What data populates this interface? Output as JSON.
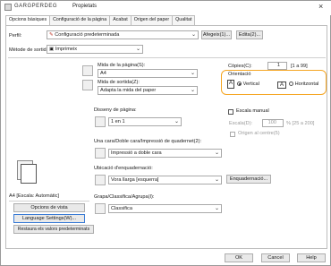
{
  "window": {
    "title": "Propietats",
    "printer_name": "GARGPERDEG"
  },
  "tabs": [
    "Opcions bàsiques",
    "Configuració de la pàgina",
    "Acabat",
    "Origen del paper",
    "Qualitat"
  ],
  "profile": {
    "label": "Perfil:",
    "value": "Configuració predeterminada",
    "add_button": "Afegeix(1)...",
    "edit_button": "Edita(2)..."
  },
  "output_method": {
    "label": "Mètode de sortida:",
    "value": "Imprimeix"
  },
  "page_size": {
    "label": "Mida de la pàgina(S):",
    "value": "A4"
  },
  "output_size": {
    "label": "Mida de sortida(Z):",
    "value": "Adapta la mida del paper"
  },
  "copies": {
    "label": "Còpies(C):",
    "value": "1",
    "range": "[1 a 99]"
  },
  "orientation": {
    "label": "Orientació",
    "vertical": "Vertical",
    "horizontal": "Horitzontal",
    "selected": "vertical"
  },
  "layout": {
    "label": "Disseny de pàgina:",
    "value": "1 en 1"
  },
  "manual_scale": {
    "label": "Escala manual",
    "scale_label": "Escala(D):",
    "scale_value": "100",
    "scale_range": "% [25 a 200]",
    "center_label": "Origen al centre(5)"
  },
  "duplex": {
    "label": "Una cara/Doble cara/Impressió de quadernet(2):",
    "value": "Impressió a doble cara"
  },
  "binding": {
    "label": "Ubicació d'enquadernació:",
    "value": "Vora llarga [esquerra]",
    "button": "Enquadernació..."
  },
  "staple": {
    "label": "Grapa/Classifica/Agrupa(I):",
    "value": "Classifica"
  },
  "preview": {
    "caption": "A4 [Escala: Automàtic]"
  },
  "side_buttons": {
    "view_options": "Opcions de vista",
    "language": "Language Settings(W)...",
    "restore": "Restaura els valors predeterminats"
  },
  "footer": {
    "ok": "OK",
    "cancel": "Cancel",
    "help": "Help"
  },
  "colors": {
    "highlight": "#f5a623",
    "selected_bg": "#3a7bd5"
  }
}
